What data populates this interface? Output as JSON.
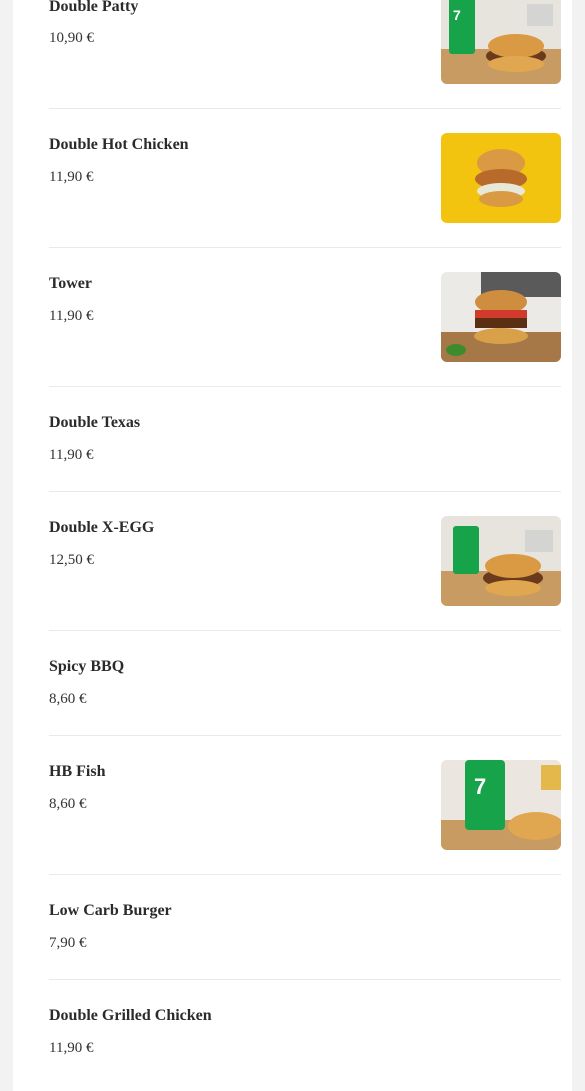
{
  "items": [
    {
      "name": "Double Patty",
      "price": "10,90 €",
      "image": "burger-with-7up-photo"
    },
    {
      "name": "Double Hot Chicken​",
      "price": "11,90 €",
      "image": "chicken-burger-yellow-bg-photo"
    },
    {
      "name": "Tower",
      "price": "11,90 €",
      "image": "tower-burger-photo"
    },
    {
      "name": "Double Texas",
      "price": "11,90 €"
    },
    {
      "name": "Double X-EGG",
      "price": "12,50 €",
      "image": "burger-with-7up-photo"
    },
    {
      "name": "Spicy BBQ",
      "price": "8,60 €"
    },
    {
      "name": "HB Fish",
      "price": "8,60 €",
      "image": "fish-burger-with-7up-photo"
    },
    {
      "name": "Low Carb Burger",
      "price": "7,90 €"
    },
    {
      "name": "Double Grilled Chicken ​",
      "price": "11,90 €"
    }
  ],
  "colors": {
    "background": "#f2f2f2",
    "card": "#ffffff",
    "divider": "#e9e9e9",
    "text": "#2b2b2b"
  }
}
